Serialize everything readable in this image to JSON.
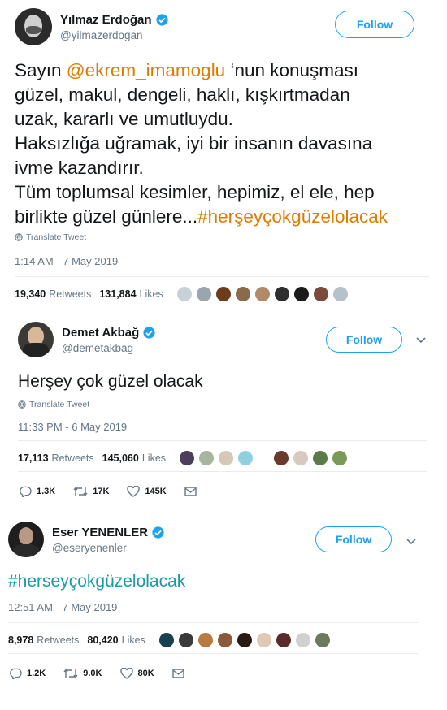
{
  "tweet1": {
    "name": "Yılmaz Erdoğan",
    "handle": "@yilmazerdogan",
    "follow_label": "Follow",
    "text_prefix": "Sayın ",
    "mention": "@ekrem_imamoglu",
    "text_line1_rest": " ‘nun konuşması",
    "text_line2": "güzel, makul, dengeli, haklı, kışkırtmadan",
    "text_line3": "uzak, kararlı ve umutluydu.",
    "text_line4": "Haksızlığa uğramak, iyi bir insanın davasına",
    "text_line5": "ivme kazandırır.",
    "text_line6": "Tüm toplumsal kesimler, hepimiz, el ele, hep",
    "text_line7_prefix": "birlikte güzel günlere...",
    "hashtag": "#herşeyçokgüzelolacak",
    "translate": "Translate Tweet",
    "time": "1:14 AM - 7 May 2019",
    "retweets": "19,340",
    "retweets_label": "Retweets",
    "likes": "131,884",
    "likes_label": "Likes"
  },
  "tweet2": {
    "name": "Demet Akbağ",
    "handle": "@demetakbag",
    "follow_label": "Follow",
    "text": "Herşey çok güzel olacak",
    "translate": "Translate Tweet",
    "time": "11:33 PM - 6 May 2019",
    "retweets": "17,113",
    "retweets_label": "Retweets",
    "likes": "145,060",
    "likes_label": "Likes",
    "replies_count": "1.3K",
    "retweet_count": "17K",
    "like_count": "145K"
  },
  "tweet3": {
    "name": "Eser YENENLER",
    "handle": "@eseryenenler",
    "follow_label": "Follow",
    "hashtag": "#herseyçokgüzelolacak",
    "time": "12:51 AM - 7 May 2019",
    "retweets": "8,978",
    "retweets_label": "Retweets",
    "likes": "80,420",
    "likes_label": "Likes",
    "replies_count": "1.2K",
    "retweet_count": "9.0K",
    "like_count": "80K"
  },
  "colors": {
    "twitter_blue": "#1da1f2",
    "hashtag_orange": "#e07b00",
    "hashtag_teal": "#1a9aa4",
    "gray": "#657786"
  },
  "icons": [
    "verified-badge-icon",
    "globe-icon",
    "reply-icon",
    "retweet-icon",
    "heart-icon",
    "message-icon",
    "chevron-down-icon"
  ]
}
